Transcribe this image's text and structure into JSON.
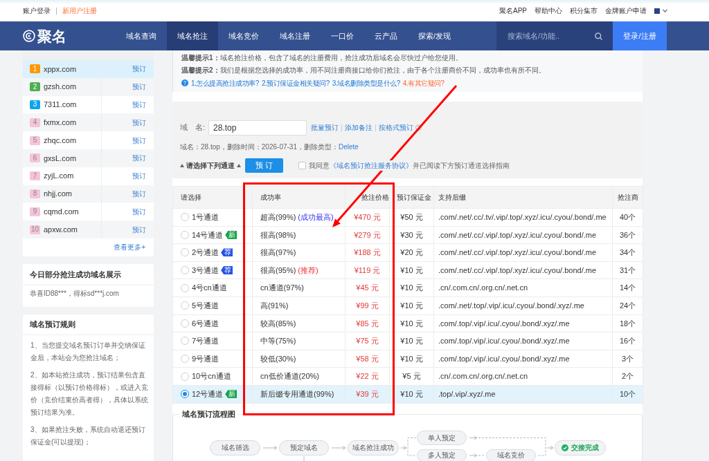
{
  "top_bar": {
    "left_links": [
      {
        "text": "账户登录",
        "kind": "plain"
      },
      {
        "text": "新用户注册",
        "kind": "highlight"
      }
    ],
    "right_links": [
      "聚名APP",
      "帮助中心",
      "积分集市",
      "金牌账户申请"
    ]
  },
  "nav": {
    "logo": "聚名",
    "items": [
      {
        "label": "域名查询",
        "selected": false
      },
      {
        "label": "域名抢注",
        "selected": true
      },
      {
        "label": "域名竞价",
        "selected": false
      },
      {
        "label": "域名注册",
        "selected": false
      },
      {
        "label": "一口价",
        "selected": false
      },
      {
        "label": "云产品",
        "selected": false
      },
      {
        "label": "探索/发现",
        "selected": false
      }
    ],
    "search": {
      "placeholder": "搜索域名/功能.."
    },
    "login_button": "登录/注册"
  },
  "sidebar": {
    "ranking": {
      "items": [
        {
          "rank": "1",
          "domain": "xppx.com",
          "action": "预订",
          "color": "#ff9800",
          "selected": true
        },
        {
          "rank": "2",
          "domain": "gzsh.com",
          "action": "预订",
          "color": "#4caf50",
          "selected": false
        },
        {
          "rank": "3",
          "domain": "7311.com",
          "action": "预订",
          "color": "#0ea5ef",
          "selected": false
        },
        {
          "rank": "4",
          "domain": "fxmx.com",
          "action": "预订",
          "color": "#f5c3da",
          "selected": false
        },
        {
          "rank": "5",
          "domain": "zhqc.com",
          "action": "预订",
          "color": "#f5c3da",
          "selected": false
        },
        {
          "rank": "6",
          "domain": "gxsL.com",
          "action": "预订",
          "color": "#f5c3da",
          "selected": false
        },
        {
          "rank": "7",
          "domain": "zyjL.com",
          "action": "预订",
          "color": "#f5c3da",
          "selected": false
        },
        {
          "rank": "8",
          "domain": "nhjj.com",
          "action": "预订",
          "color": "#f5c3da",
          "selected": false
        },
        {
          "rank": "9",
          "domain": "cqmd.com",
          "action": "预订",
          "color": "#f5c3da",
          "selected": false
        },
        {
          "rank": "10",
          "domain": "apxw.com",
          "action": "预订",
          "color": "#f5c3da",
          "selected": false
        }
      ],
      "more_link": "查看更多+"
    },
    "winners": {
      "title": "今日部分抢注成功域名展示",
      "text": "恭喜ID88***，得标sd***j.com"
    },
    "rules": {
      "title": "域名预订规则",
      "paragraphs": [
        "1、当您提交域名预订订单并交纳保证金后，本站会为您抢注域名；",
        "2、如本站抢注成功，预订结果包含直接得标（以预订价格得标），或进入竞价（竞价结束价高者得），具体以系统预订结果为准。",
        "3、如果抢注失败，系统自动退还预订保证金(可以提现)；"
      ]
    }
  },
  "notice": {
    "tips": [
      "**温馨提示1：**域名抢注价格，包含了域名的注册费用，抢注成功后域名会尽快过户给您使用。",
      "**温馨提示2：**我们是根据您选择的成功率，用不同注册商接口给你们抢注，由于各个注册商价不同，成功率也有所不同。"
    ],
    "help_links": [
      {
        "text": "1.怎么提高抢注成功率?",
        "kind": "normal"
      },
      {
        "text": "2.预订保证金相关疑问?",
        "kind": "normal"
      },
      {
        "text": "3.域名删除类型是什么?",
        "kind": "normal"
      },
      {
        "text": "4.有其它疑问?",
        "kind": "highlight"
      }
    ]
  },
  "order_form": {
    "domain_label": "域　名:",
    "domain_value": "28.top",
    "links": [
      "批量预订",
      "添加备注",
      "按格式预订"
    ],
    "info": "域名：28.top，删除时间：2026-07-31，删除类型：",
    "delete_type": "Delete",
    "channel_hint": "请选择下列通道",
    "submit_button": "预 订",
    "agreement": {
      "checked": false,
      "prefix": "我同意",
      "link": "《域名预订抢注服务协议》",
      "suffix": "并已阅读下方预订通道选择指南"
    }
  },
  "channel_table": {
    "columns": [
      "请选择",
      "成功率",
      "抢注价格",
      "预订保证金",
      "支持后缀",
      "抢注商"
    ],
    "rows": [
      {
        "selected": false,
        "channel": "1号通道",
        "rate": "超高(99%)",
        "note": {
          "text": "(成功最高)",
          "kind": "best"
        },
        "price": "¥470 元",
        "deposit": "¥50 元",
        "suffixes": ".com/.net/.cc/.tv/.vip/.top/.xyz/.icu/.cyou/.bond/.me",
        "registrars": "40个"
      },
      {
        "selected": false,
        "channel": "14号通道",
        "tag": {
          "text": "新",
          "kind": "new"
        },
        "rate": "很高(98%)",
        "price": "¥279 元",
        "deposit": "¥30 元",
        "suffixes": ".com/.net/.cc/.vip/.top/.xyz/.icu/.cyou/.bond/.me",
        "registrars": "36个"
      },
      {
        "selected": false,
        "channel": "2号通道",
        "tag": {
          "text": "荐",
          "kind": "recommend"
        },
        "rate": "很高(97%)",
        "price": "¥188 元",
        "deposit": "¥20 元",
        "suffixes": ".com/.net/.cc/.vip/.top/.xyz/.icu/.cyou/.bond/.me",
        "registrars": "34个"
      },
      {
        "selected": false,
        "channel": "3号通道",
        "tag": {
          "text": "荐",
          "kind": "recommend"
        },
        "rate": "很高(95%)",
        "note": {
          "text": "(推荐)",
          "kind": "recommend"
        },
        "price": "¥119 元",
        "deposit": "¥10 元",
        "suffixes": ".com/.net/.cc/.vip/.top/.xyz/.icu/.cyou/.bond/.me",
        "registrars": "31个"
      },
      {
        "selected": false,
        "channel": "4号cn通道",
        "rate": "cn通道(97%)",
        "price": "¥45 元",
        "deposit": "¥10 元",
        "suffixes": ".cn/.com.cn/.org.cn/.net.cn",
        "registrars": "14个"
      },
      {
        "selected": false,
        "channel": "5号通道",
        "rate": "高(91%)",
        "price": "¥99 元",
        "deposit": "¥10 元",
        "suffixes": ".com/.net/.top/.vip/.icu/.cyou/.bond/.xyz/.me",
        "registrars": "24个"
      },
      {
        "selected": false,
        "channel": "6号通道",
        "rate": "较高(85%)",
        "price": "¥85 元",
        "deposit": "¥10 元",
        "suffixes": ".com/.top/.vip/.icu/.cyou/.bond/.xyz/.me",
        "registrars": "18个"
      },
      {
        "selected": false,
        "channel": "7号通道",
        "rate": "中等(75%)",
        "price": "¥75 元",
        "deposit": "¥10 元",
        "suffixes": ".com/.top/.vip/.icu/.cyou/.bond/.xyz/.me",
        "registrars": "16个"
      },
      {
        "selected": false,
        "channel": "9号通道",
        "rate": "较低(30%)",
        "price": "¥58 元",
        "deposit": "¥10 元",
        "suffixes": ".com/.top/.vip/.icu/.cyou/.bond/.xyz/.me",
        "registrars": "3个"
      },
      {
        "selected": false,
        "channel": "10号cn通道",
        "rate": "cn低价通道(20%)",
        "price": "¥22 元",
        "deposit": "¥5 元",
        "suffixes": ".cn/.com.cn/.org.cn/.net.cn",
        "registrars": "2个"
      },
      {
        "selected": true,
        "channel": "12号通道",
        "tag": {
          "text": "新",
          "kind": "new"
        },
        "rate": "新后缀专用通道(99%)",
        "price": "¥39 元",
        "deposit": "¥10 元",
        "suffixes": ".top/.vip/.xyz/.me",
        "registrars": "10个"
      }
    ]
  },
  "flow_chart": {
    "title": "域名预订流程图",
    "nodes": [
      {
        "label": "域名筛选",
        "kind": "step"
      },
      {
        "label": "预定域名",
        "kind": "step"
      },
      {
        "label": "域名抢注成功",
        "kind": "step"
      },
      {
        "label": "单人预定",
        "kind": "step"
      },
      {
        "label": "多人预定",
        "kind": "step"
      },
      {
        "label": "域名竞价",
        "kind": "step"
      },
      {
        "label": "交接完成",
        "kind": "done"
      }
    ]
  }
}
